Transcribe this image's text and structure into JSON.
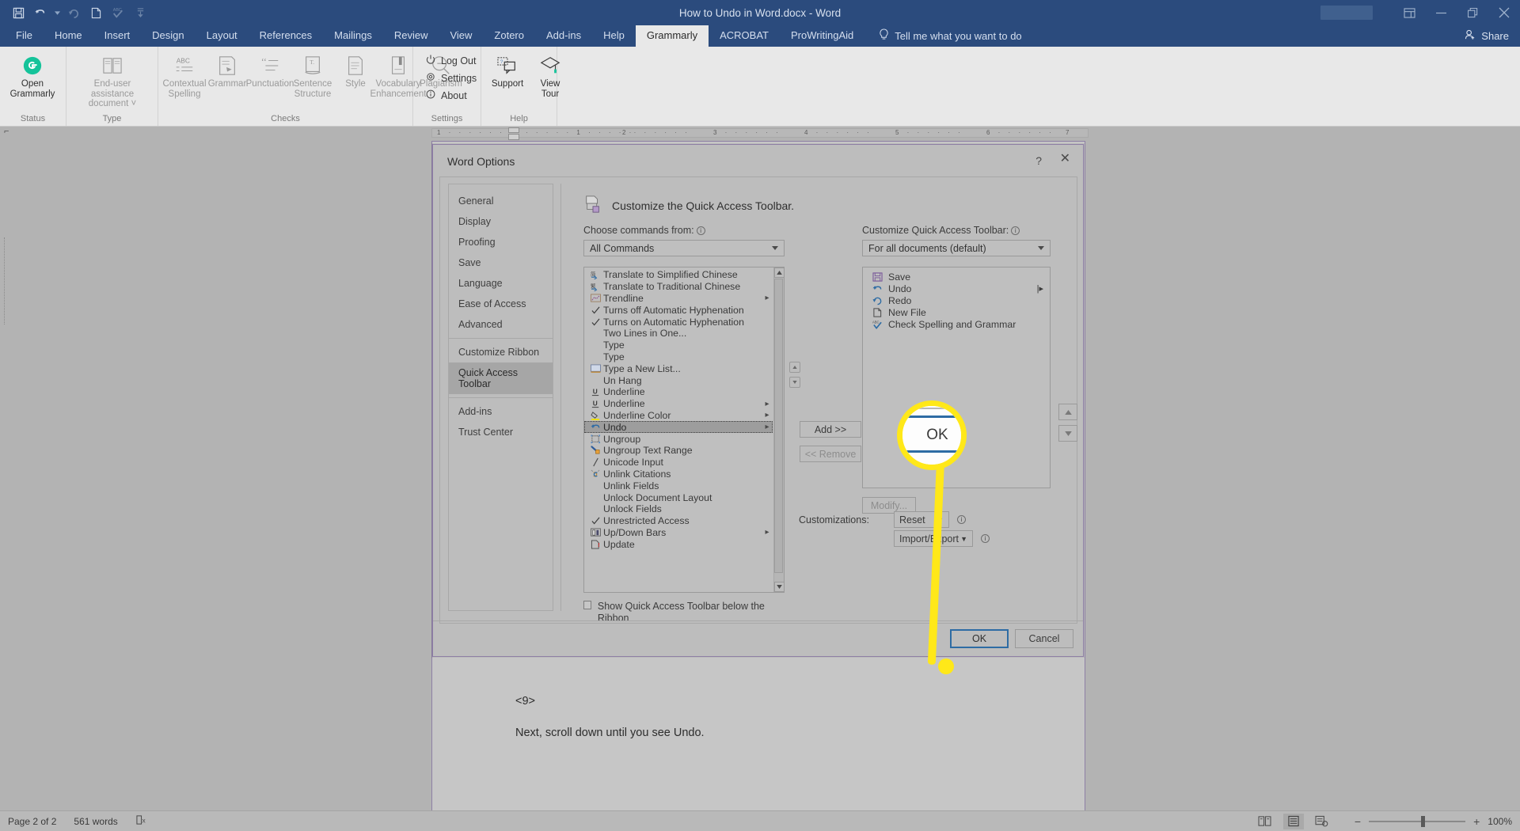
{
  "titlebar": {
    "document_title": "How to Undo in Word.docx  -  Word",
    "qat_icons": [
      "save-icon",
      "undo-icon",
      "undo-dropdown-icon",
      "redo-icon",
      "new-file-icon",
      "spelling-check-icon",
      "customize-qat-icon"
    ],
    "window_controls": [
      "ribbon-display-options-icon",
      "minimize-icon",
      "restore-icon",
      "close-icon"
    ],
    "share_label": "Share"
  },
  "ribbon_tabs": [
    {
      "label": "File",
      "active": false
    },
    {
      "label": "Home",
      "active": false
    },
    {
      "label": "Insert",
      "active": false
    },
    {
      "label": "Design",
      "active": false
    },
    {
      "label": "Layout",
      "active": false
    },
    {
      "label": "References",
      "active": false
    },
    {
      "label": "Mailings",
      "active": false
    },
    {
      "label": "Review",
      "active": false
    },
    {
      "label": "View",
      "active": false
    },
    {
      "label": "Zotero",
      "active": false
    },
    {
      "label": "Add-ins",
      "active": false
    },
    {
      "label": "Help",
      "active": false
    },
    {
      "label": "Grammarly",
      "active": true
    },
    {
      "label": "ACROBAT",
      "active": false
    },
    {
      "label": "ProWritingAid",
      "active": false
    }
  ],
  "tell_me": {
    "label": "Tell me what you want to do",
    "icon": "lightbulb-icon"
  },
  "ribbon_groups": [
    {
      "name": "Status",
      "label": "Status",
      "items": [
        {
          "label": "Open\nGrammarly",
          "icon": "grammarly-logo-icon",
          "enabled": true
        }
      ]
    },
    {
      "name": "Type",
      "label": "Type",
      "items": [
        {
          "label": "End-user assistance\ndocument ~",
          "icon": "book-icon",
          "enabled": false
        }
      ]
    },
    {
      "name": "Checks",
      "label": "Checks",
      "items": [
        {
          "label": "Contextual\nSpelling",
          "icon": "abc-spelling-icon",
          "enabled": false
        },
        {
          "label": "Grammar",
          "icon": "grammar-icon",
          "enabled": false
        },
        {
          "label": "Punctuation",
          "icon": "punctuation-icon",
          "enabled": false
        },
        {
          "label": "Sentence\nStructure",
          "icon": "sentence-structure-icon",
          "enabled": false
        },
        {
          "label": "Style",
          "icon": "style-icon",
          "enabled": false
        },
        {
          "label": "Vocabulary\nEnhancement",
          "icon": "vocabulary-icon",
          "enabled": false
        },
        {
          "label": "Plagiarism",
          "icon": "plagiarism-icon",
          "enabled": false
        }
      ]
    },
    {
      "name": "Settings",
      "label": "Settings",
      "menu": [
        {
          "label": "Log Out",
          "icon": "power-icon"
        },
        {
          "label": "Settings",
          "icon": "gear-icon"
        },
        {
          "label": "About",
          "icon": "info-icon"
        }
      ]
    },
    {
      "name": "Help",
      "label": "Help",
      "items": [
        {
          "label": "Support",
          "icon": "support-chat-icon",
          "enabled": true
        },
        {
          "label": "View\nTour",
          "icon": "view-tour-icon",
          "enabled": true
        }
      ]
    }
  ],
  "ruler": {
    "marks": [
      "1",
      "1",
      "2",
      "3",
      "4",
      "5",
      "6",
      "7"
    ]
  },
  "document": {
    "line1": "<9>",
    "line2": "Next, scroll down until you see Undo."
  },
  "dialog": {
    "title": "Word Options",
    "help_icon": "?",
    "close_icon": "✕",
    "nav_items": [
      {
        "label": "General",
        "selected": false
      },
      {
        "label": "Display",
        "selected": false
      },
      {
        "label": "Proofing",
        "selected": false
      },
      {
        "label": "Save",
        "selected": false
      },
      {
        "label": "Language",
        "selected": false
      },
      {
        "label": "Ease of Access",
        "selected": false
      },
      {
        "label": "Advanced",
        "selected": false
      },
      {
        "label": "Customize Ribbon",
        "selected": false
      },
      {
        "label": "Quick Access Toolbar",
        "selected": true
      },
      {
        "label": "Add-ins",
        "selected": false
      },
      {
        "label": "Trust Center",
        "selected": false
      }
    ],
    "pane_heading": "Customize the Quick Access Toolbar.",
    "pane_heading_icon": "customize-qat-icon",
    "choose_commands_label": "Choose commands from:",
    "choose_commands_value": "All Commands",
    "customize_qat_label": "Customize Quick Access Toolbar:",
    "customize_qat_value": "For all documents (default)",
    "commands_list": [
      {
        "label": "Translate to Simplified Chinese",
        "icon": "translate-simplified-icon",
        "check": false,
        "submenu": false
      },
      {
        "label": "Translate to Traditional Chinese",
        "icon": "translate-traditional-icon",
        "check": false,
        "submenu": false
      },
      {
        "label": "Trendline",
        "icon": "trendline-icon",
        "check": false,
        "submenu": true
      },
      {
        "label": "Turns off Automatic Hyphenation",
        "icon": "",
        "check": true,
        "submenu": false
      },
      {
        "label": "Turns on Automatic Hyphenation",
        "icon": "",
        "check": true,
        "submenu": false
      },
      {
        "label": "Two Lines in One...",
        "icon": "",
        "check": false,
        "submenu": false
      },
      {
        "label": "Type",
        "icon": "",
        "check": false,
        "submenu": false
      },
      {
        "label": "Type",
        "icon": "",
        "check": false,
        "submenu": false
      },
      {
        "label": "Type a New List...",
        "icon": "new-list-icon",
        "check": false,
        "submenu": false
      },
      {
        "label": "Un Hang",
        "icon": "",
        "check": false,
        "submenu": false
      },
      {
        "label": "Underline",
        "icon": "underline-icon",
        "check": false,
        "submenu": false
      },
      {
        "label": "Underline",
        "icon": "underline-icon",
        "check": false,
        "submenu": true
      },
      {
        "label": "Underline Color",
        "icon": "underline-color-icon",
        "check": false,
        "submenu": true
      },
      {
        "label": "Undo",
        "icon": "undo-icon",
        "check": false,
        "submenu": true,
        "selected": true
      },
      {
        "label": "Ungroup",
        "icon": "ungroup-icon",
        "check": false,
        "submenu": false
      },
      {
        "label": "Ungroup Text Range",
        "icon": "ungroup-text-range-icon",
        "check": false,
        "submenu": false
      },
      {
        "label": "Unicode Input",
        "icon": "unicode-input-icon",
        "check": false,
        "submenu": false
      },
      {
        "label": "Unlink Citations",
        "icon": "unlink-citations-icon",
        "check": false,
        "submenu": false
      },
      {
        "label": "Unlink Fields",
        "icon": "",
        "check": false,
        "submenu": false
      },
      {
        "label": "Unlock Document Layout",
        "icon": "",
        "check": false,
        "submenu": false
      },
      {
        "label": "Unlock Fields",
        "icon": "",
        "check": false,
        "submenu": false
      },
      {
        "label": "Unrestricted Access",
        "icon": "",
        "check": true,
        "submenu": false
      },
      {
        "label": "Up/Down Bars",
        "icon": "up-down-bars-icon",
        "check": false,
        "submenu": true
      },
      {
        "label": "Update",
        "icon": "update-icon",
        "check": false,
        "submenu": false
      }
    ],
    "qat_list": [
      {
        "label": "Save",
        "icon": "save-icon"
      },
      {
        "label": "Undo",
        "icon": "undo-icon"
      },
      {
        "label": "Redo",
        "icon": "redo-icon"
      },
      {
        "label": "New File",
        "icon": "new-file-icon"
      },
      {
        "label": "Check Spelling and Grammar",
        "icon": "spelling-check-icon"
      }
    ],
    "add_button": "Add >>",
    "remove_button": "<< Remove",
    "modify_button": "Modify...",
    "customizations_label": "Customizations:",
    "reset_button": "Reset",
    "import_export_button": "Import/Export",
    "show_below_checkbox": "Show Quick Access Toolbar below the Ribbon",
    "show_below_checked": false,
    "ok_button": "OK",
    "cancel_button": "Cancel",
    "move_up_icon": "move-up-icon",
    "move_down_icon": "move-down-icon"
  },
  "callout": {
    "magnified_label": "OK",
    "highlight_color": "#ffe819"
  },
  "statusbar": {
    "page": "Page 2 of 2",
    "words": "561 words",
    "proofing_icon": "proofing-errors-icon",
    "view_buttons": [
      "read-mode-icon",
      "print-layout-icon",
      "web-layout-icon"
    ],
    "zoom_out": "−",
    "zoom_in": "+",
    "zoom_level": "100%"
  }
}
